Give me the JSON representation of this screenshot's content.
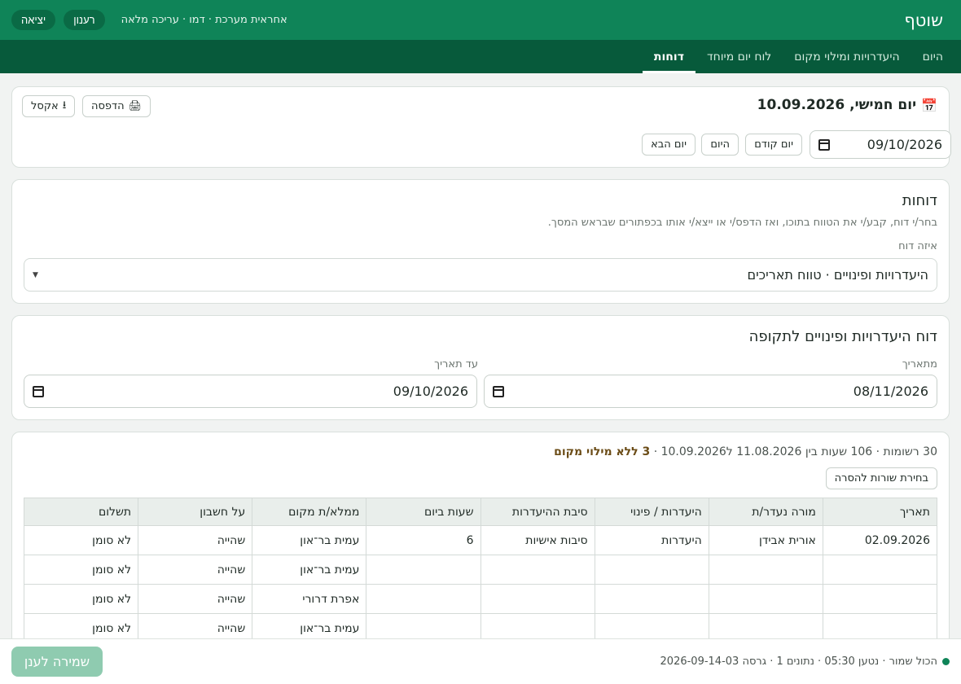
{
  "app": {
    "brand": "שוטף",
    "user_info": "אחראית מערכת · דמו · עריכה מלאה",
    "refresh": "רענון",
    "logout": "יציאה"
  },
  "nav": {
    "tabs": [
      {
        "label": "היום",
        "active": false
      },
      {
        "label": "היעדרויות ומילוי מקום",
        "active": false
      },
      {
        "label": "לוח יום מיוחד",
        "active": false
      },
      {
        "label": "דוחות",
        "active": true
      }
    ]
  },
  "day_bar": {
    "title": "יום חמישי, 10.09.2026",
    "print": "הדפסה",
    "excel": "אקסל",
    "date_value": "09/10/2026",
    "prev": "יום קודם",
    "today": "היום",
    "next": "יום הבא"
  },
  "reports": {
    "title": "דוחות",
    "hint": "בחר/י דוח, קבע/י את הטווח בתוכו, ואז הדפס/י או ייצא/י אותו בכפתורים שבראש המסך.",
    "select_label": "איזה דוח",
    "selected": "היעדרויות ופינויים · טווח תאריכים"
  },
  "range": {
    "title": "דוח היעדרויות ופינויים לתקופה",
    "from_label": "מתאריך",
    "from_value": "08/11/2026",
    "to_label": "עד תאריך",
    "to_value": "09/10/2026"
  },
  "results": {
    "summary": "30 רשומות · 106 שעות בין 11.08.2026 ל10.09.2026 · ",
    "warning": "3 ללא מילוי מקום",
    "select_rows": "בחירת שורות להסרה",
    "columns": [
      "תאריך",
      "מורה נעדר/ת",
      "היעדרות / פינוי",
      "סיבת ההיעדרות",
      "שעות ביום",
      "ממלא/ת מקום",
      "על חשבון",
      "תשלום"
    ],
    "rows": [
      [
        "02.09.2026",
        "אורית אבידן",
        "היעדרות",
        "סיבות אישיות",
        "6",
        "עמית בר־און",
        "שהייה",
        "לא סומן"
      ],
      [
        "",
        "",
        "",
        "",
        "",
        "עמית בר־און",
        "שהייה",
        "לא סומן"
      ],
      [
        "",
        "",
        "",
        "",
        "",
        "אפרת דרורי",
        "שהייה",
        "לא סומן"
      ],
      [
        "",
        "",
        "",
        "",
        "",
        "עמית בר־און",
        "שהייה",
        "לא סומן"
      ]
    ]
  },
  "footer": {
    "status": "הכול שמור · נטען 05:30 · נתונים 1 · גרסה 2026-09-14-03",
    "save": "שמירה לענן"
  },
  "colors": {
    "brand": "#0f8458",
    "nav": "#075a3b",
    "warning": "#6b4c17"
  }
}
